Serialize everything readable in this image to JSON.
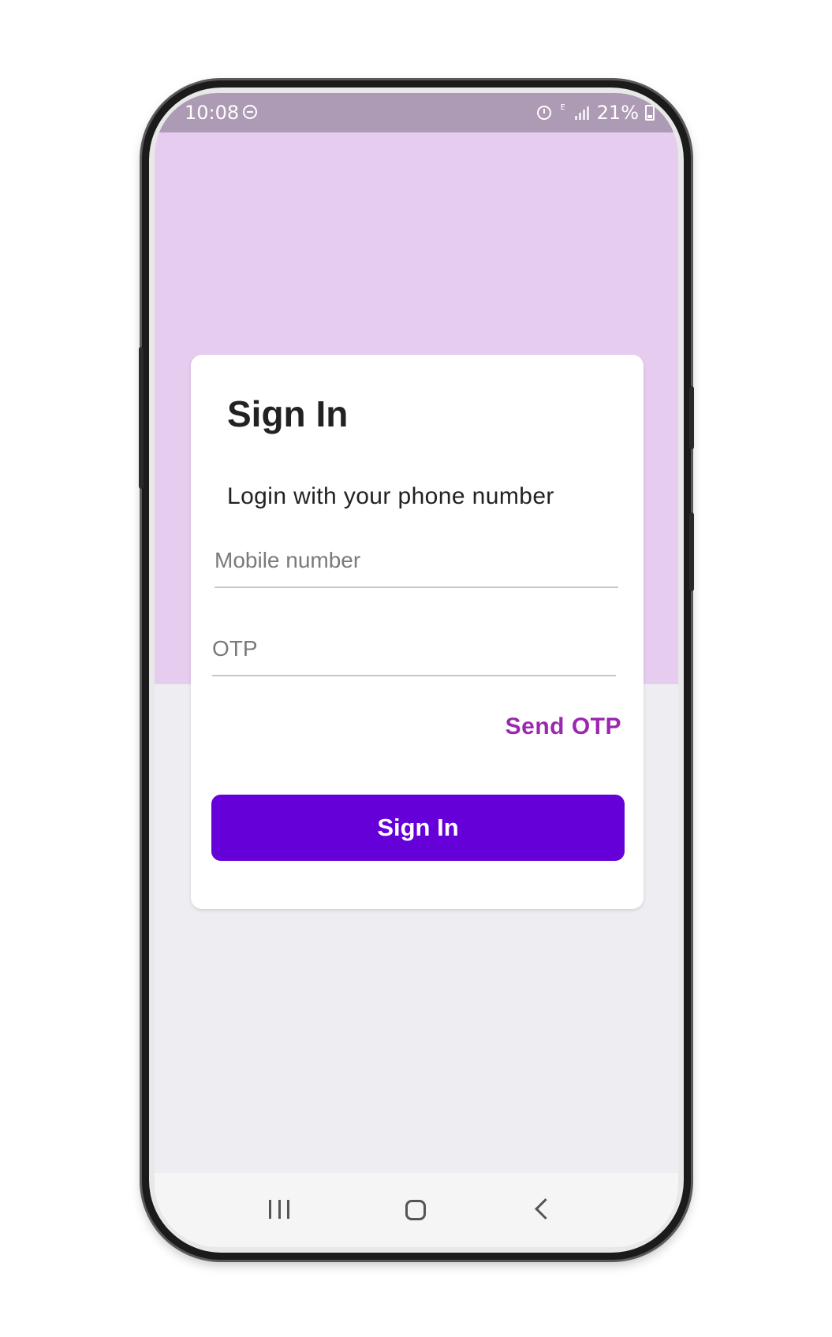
{
  "status_bar": {
    "time": "10:08",
    "battery": "21%",
    "data_indicator": "E"
  },
  "card": {
    "title": "Sign In",
    "subtitle": "Login with your phone number"
  },
  "form": {
    "mobile_placeholder": "Mobile number",
    "otp_placeholder": "OTP",
    "send_otp_label": "Send OTP",
    "submit_label": "Sign In"
  },
  "colors": {
    "header_bg": "#e6ccef",
    "status_bar_bg": "#ad9ab4",
    "primary_button": "#6600d8",
    "link": "#9c27b0",
    "page_bg": "#eeeef2"
  },
  "icons": {
    "status": [
      "dnd-icon",
      "alarm-icon",
      "data-icon",
      "signal-icon",
      "battery-icon"
    ],
    "navigation": [
      "recents-icon",
      "home-icon",
      "back-icon"
    ]
  }
}
